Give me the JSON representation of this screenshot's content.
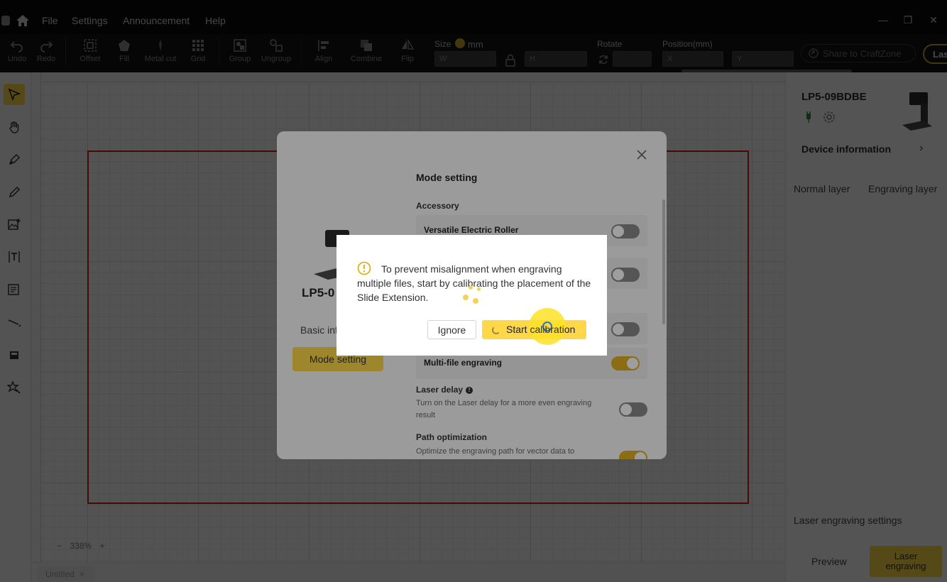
{
  "menu": {
    "items": [
      "File",
      "Settings",
      "Announcement",
      "Help"
    ],
    "window_controls": [
      "—",
      "❐",
      "✕"
    ]
  },
  "toolbar": {
    "tools": [
      {
        "label": "Undo",
        "icon": "undo-icon"
      },
      {
        "label": "Redo",
        "icon": "redo-icon"
      },
      {
        "label": "Offset",
        "icon": "offset-icon"
      },
      {
        "label": "Fill",
        "icon": "fill-icon"
      },
      {
        "label": "Metal cut",
        "icon": "metal-cut-icon"
      },
      {
        "label": "Grid",
        "icon": "grid-icon"
      },
      {
        "label": "Group",
        "icon": "group-icon"
      },
      {
        "label": "Ungroup",
        "icon": "ungroup-icon"
      },
      {
        "label": "Align",
        "icon": "align-icon"
      },
      {
        "label": "Combine",
        "icon": "combine-icon"
      },
      {
        "label": "Flip",
        "icon": "flip-icon"
      }
    ],
    "size_label": "Size",
    "unit": "mm",
    "width_placeholder": "W",
    "height_placeholder": "H",
    "rotate_label": "Rotate",
    "position_label": "Position(mm)",
    "x_placeholder": "X",
    "y_placeholder": "Y",
    "share_label": "Share to CraftZone",
    "laser_label": "Las"
  },
  "canvas": {
    "zoom": "338%",
    "zoom_minus": "−",
    "zoom_plus": "+",
    "document_tab": "Untitled"
  },
  "right_panel": {
    "device_name": "LP5-09BDBE",
    "device_information": "Device information",
    "tabs": [
      "Normal layer",
      "Engraving layer"
    ],
    "laser_engraving_settings": "Laser engraving settings",
    "preview_label": "Preview",
    "laser_engraving_button": "Laser engraving"
  },
  "mode_dialog": {
    "device_name": "LP5-0",
    "basic_info": "Basic inf",
    "mode_setting_button": "Mode setting",
    "title": "Mode setting",
    "accessory_section": "Accessory",
    "versatile_roller": "Versatile Electric Roller",
    "multi_file": "Multi-file engraving",
    "laser_delay_title": "Laser delay",
    "laser_delay_desc": "Turn on the Laser delay for a more even engraving result",
    "path_opt_title": "Path optimization",
    "path_opt_desc": "Optimize the engraving path for vector data to"
  },
  "calibration_prompt": {
    "message": "To prevent misalignment when engraving multiple files, start by calibrating the placement of the Slide Extension.",
    "ignore_label": "Ignore",
    "start_label": "Start calibration"
  },
  "colors": {
    "accent": "#ffd84a",
    "work_area_border": "#d61c1c",
    "toggle_on": "#e2b021"
  }
}
